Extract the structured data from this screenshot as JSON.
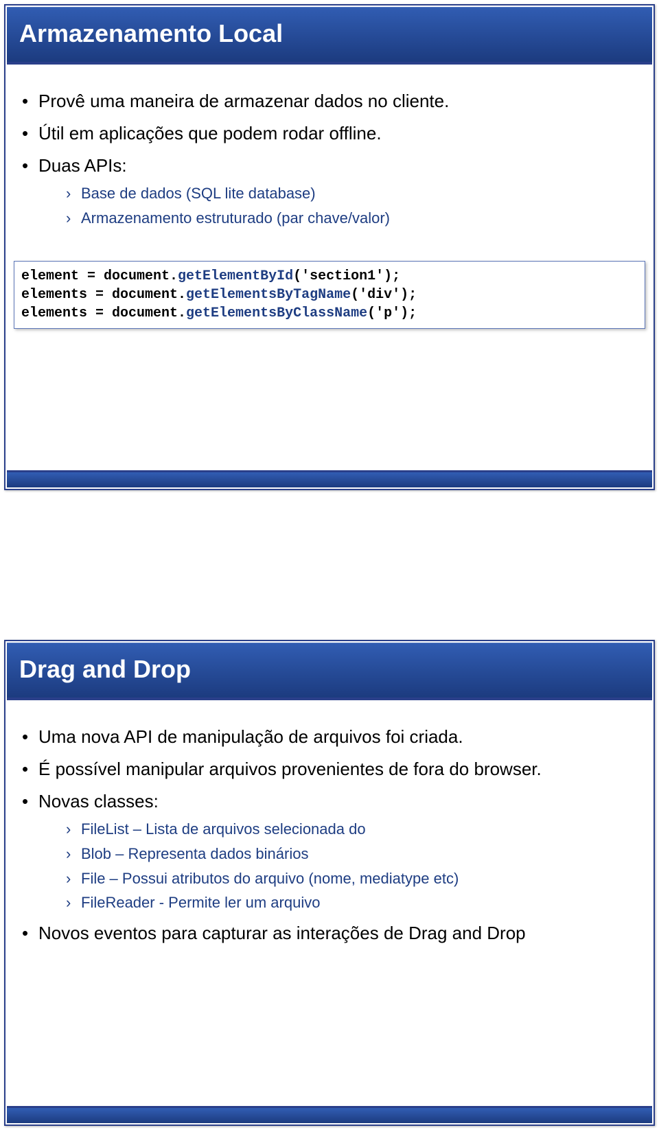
{
  "slide1": {
    "title": "Armazenamento Local",
    "bullets": [
      "Provê uma maneira de armazenar dados no cliente.",
      "Útil em aplicações que podem rodar offline.",
      "Duas APIs:"
    ],
    "sub_bullets": [
      "Base de dados (SQL lite database)",
      "Armazenamento estruturado (par chave/valor)"
    ],
    "code": {
      "l1a": "element = document.",
      "l1b": "getElementById",
      "l1c": "('section1');",
      "l2a": "elements = document.",
      "l2b": "getElementsByTagName",
      "l2c": "('div');",
      "l3a": "elements = document.",
      "l3b": "getElementsByClassName",
      "l3c": "('p');"
    }
  },
  "slide2": {
    "title": "Drag and Drop",
    "bullets": [
      "Uma nova API de manipulação de arquivos foi criada.",
      "É possível manipular arquivos provenientes de fora do browser.",
      "Novas classes:",
      "Novos eventos para capturar as interações de Drag and Drop"
    ],
    "sub_bullets": [
      "FileList – Lista de arquivos selecionada do",
      "Blob – Representa dados binários",
      "File – Possui atributos do arquivo (nome, mediatype etc)",
      "FileReader - Permite ler um arquivo"
    ]
  }
}
